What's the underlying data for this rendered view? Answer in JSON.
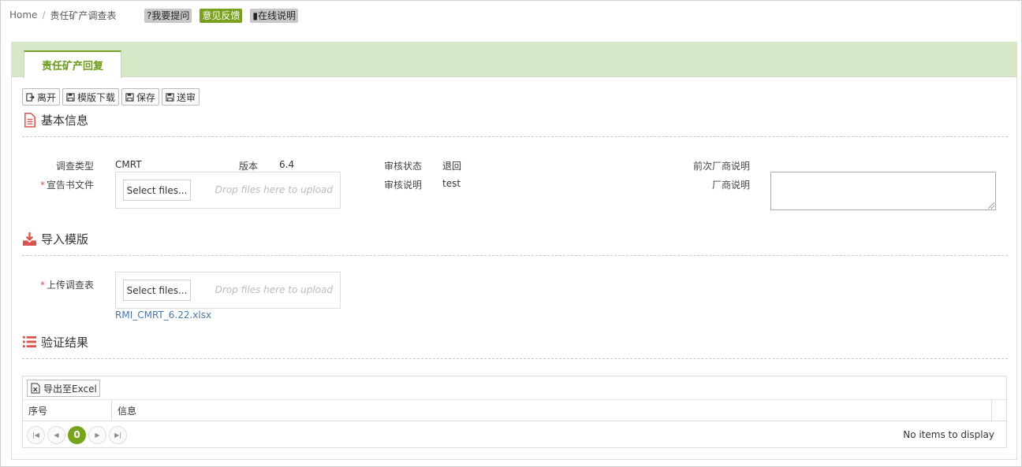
{
  "breadcrumb": {
    "home": "Home",
    "separator": "/",
    "current": "责任矿产调查表"
  },
  "help_buttons": {
    "ask": "?我要提问",
    "feedback": "意见反馈",
    "manual": "在线说明"
  },
  "tab": {
    "label": "责任矿产回复"
  },
  "toolbar": {
    "leave": "离开",
    "download_template": "模版下载",
    "save": "保存",
    "submit": "送审"
  },
  "basic_info": {
    "title": "基本信息",
    "survey_type_label": "调查类型",
    "survey_type_value": "CMRT",
    "version_label": "版本",
    "version_value": "6.4",
    "review_status_label": "审核状态",
    "review_status_value": "退回",
    "prev_vendor_note_label": "前次厂商说明",
    "declaration_file_label": "宣告书文件",
    "review_note_label": "审核说明",
    "review_note_value": "test",
    "vendor_note_label": "厂商说明"
  },
  "upload": {
    "select_label": "Select files...",
    "drop_hint": "Drop files here to upload"
  },
  "import_template": {
    "title": "导入模版",
    "upload_label": "上传调查表",
    "uploaded_file": "RMI_CMRT_6.22.xlsx"
  },
  "validation": {
    "title": "验证结果",
    "export_label": "导出至Excel",
    "columns": [
      "序号",
      "信息"
    ],
    "current_page": "0",
    "empty_text": "No items to display"
  },
  "colors": {
    "accent": "#7aa11e",
    "tab_strip": "#d6e8c7",
    "section_icon": "#d9534f"
  }
}
